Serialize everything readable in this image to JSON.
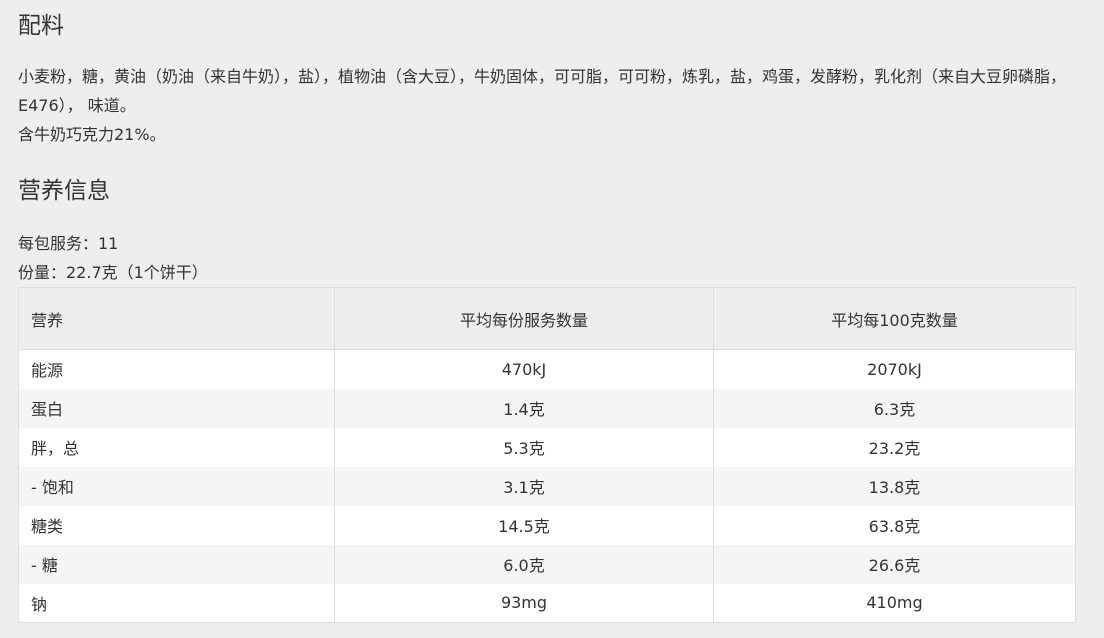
{
  "ingredients": {
    "heading": "配料",
    "lines": [
      "小麦粉，糖，黄油（奶油（来自牛奶），盐），植物油（含大豆），牛奶固体，可可脂，可可粉，炼乳，盐，鸡蛋，发酵粉，乳化剂（来自大豆卵磷脂，E476）， 味道。",
      "含牛奶巧克力21%。"
    ]
  },
  "nutrition": {
    "heading": "营养信息",
    "servings_per_pack": "每包服务：11",
    "serving_size": "份量：22.7克（1个饼干）",
    "table": {
      "headers": [
        "营养",
        "平均每份服务数量",
        "平均每100克数量"
      ],
      "rows": [
        [
          "能源",
          "470kJ",
          "2070kJ"
        ],
        [
          "蛋白",
          "1.4克",
          "6.3克"
        ],
        [
          "胖，总",
          "5.3克",
          "23.2克"
        ],
        [
          "- 饱和",
          "3.1克",
          "13.8克"
        ],
        [
          "糖类",
          "14.5克",
          "63.8克"
        ],
        [
          "- 糖",
          "6.0克",
          "26.6克"
        ],
        [
          "钠",
          "93mg",
          "410mg"
        ]
      ]
    }
  }
}
